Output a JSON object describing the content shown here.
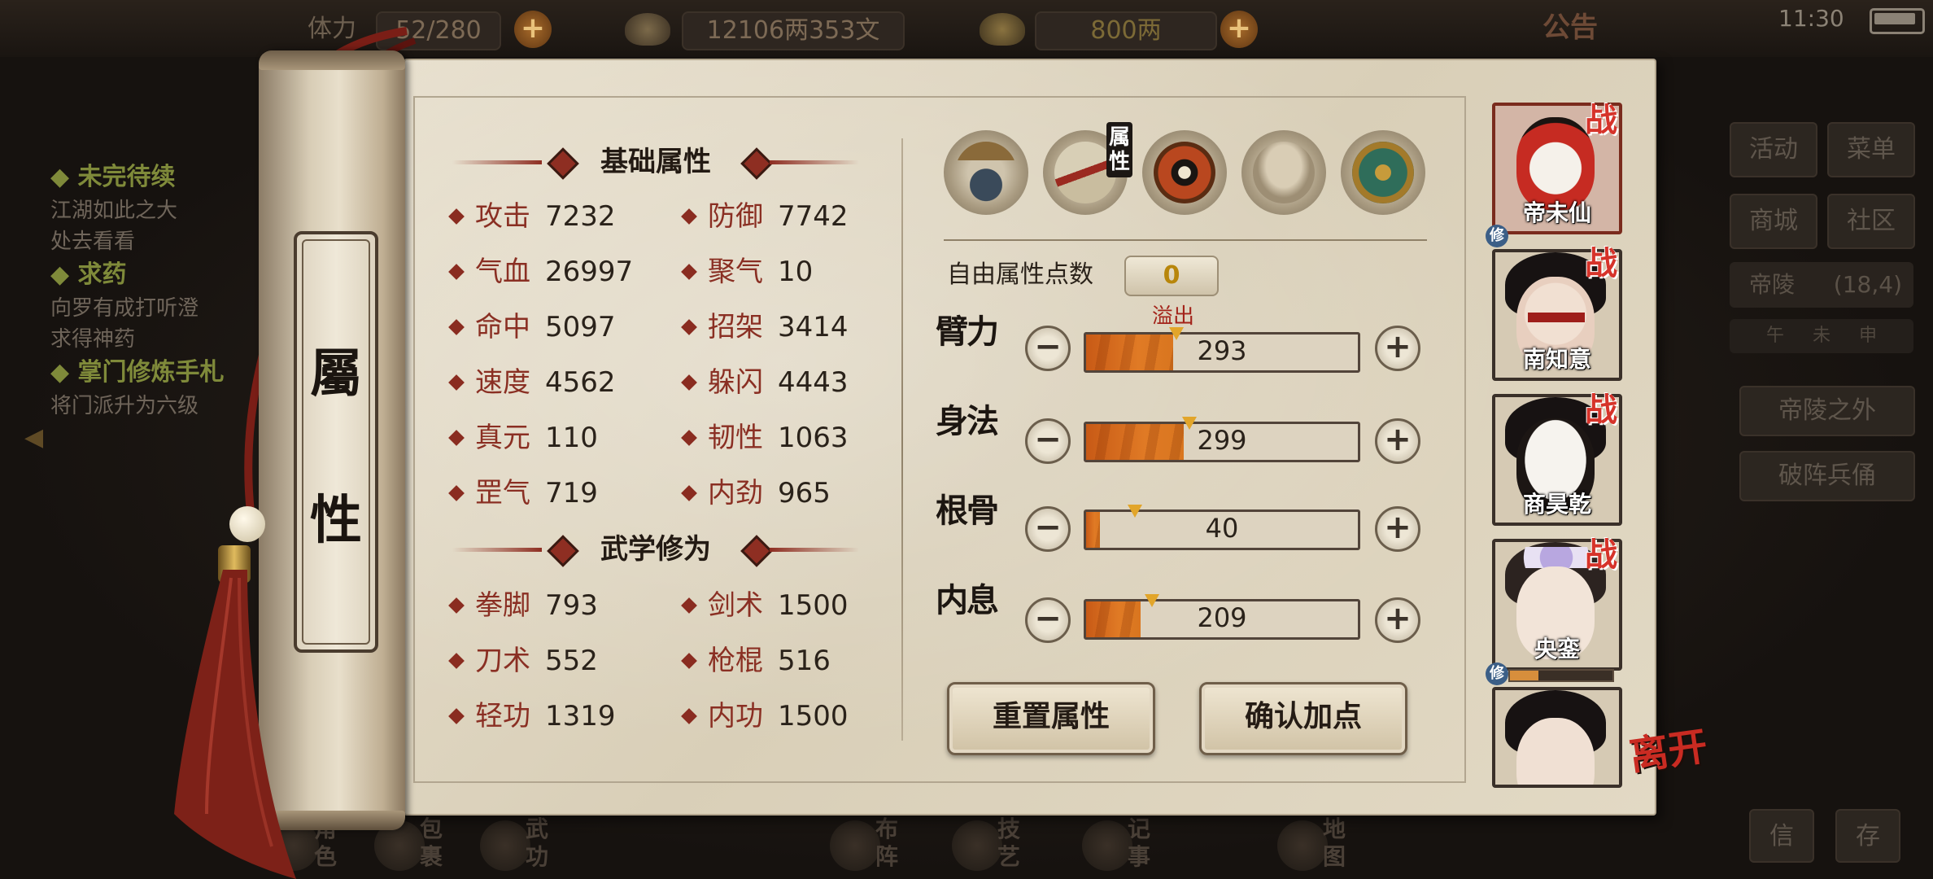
{
  "status": {
    "time": "11:30"
  },
  "topbar": {
    "stamina_label": "体力",
    "stamina": "52/280",
    "silver": "12106两353文",
    "gold": "800两",
    "notice": "公告"
  },
  "quests": [
    {
      "title": "未完待续",
      "lines": [
        "江湖如此之大",
        "处去看看"
      ]
    },
    {
      "title": "求药",
      "lines": [
        "向罗有成打听澄",
        "求得神药"
      ]
    },
    {
      "title": "掌门修炼手札",
      "lines": [
        "将门派升为六级"
      ]
    }
  ],
  "right_bg": {
    "buttons": [
      "活动",
      "菜单",
      "商城",
      "社区"
    ],
    "location": "帝陵",
    "coords": "(18,4)",
    "compass": [
      "午",
      "未",
      "申"
    ],
    "places": [
      "帝陵之外",
      "破阵兵俑"
    ],
    "bottom": [
      "信",
      "存"
    ]
  },
  "bottom_nav": [
    "角色",
    "包裹",
    "武功",
    "布阵",
    "技艺",
    "记事",
    "地图"
  ],
  "scroll_label": [
    "屬",
    "性"
  ],
  "sections": {
    "basic": "基础属性",
    "martial": "武学修为"
  },
  "basic_stats": [
    {
      "name": "攻击",
      "value": "7232"
    },
    {
      "name": "防御",
      "value": "7742"
    },
    {
      "name": "气血",
      "value": "26997"
    },
    {
      "name": "聚气",
      "value": "10"
    },
    {
      "name": "命中",
      "value": "5097"
    },
    {
      "name": "招架",
      "value": "3414"
    },
    {
      "name": "速度",
      "value": "4562"
    },
    {
      "name": "躲闪",
      "value": "4443"
    },
    {
      "name": "真元",
      "value": "110"
    },
    {
      "name": "韧性",
      "value": "1063"
    },
    {
      "name": "罡气",
      "value": "719"
    },
    {
      "name": "内劲",
      "value": "965"
    }
  ],
  "martial_stats": [
    {
      "name": "拳脚",
      "value": "793"
    },
    {
      "name": "剑术",
      "value": "1500"
    },
    {
      "name": "刀术",
      "value": "552"
    },
    {
      "name": "枪棍",
      "value": "516"
    },
    {
      "name": "轻功",
      "value": "1319"
    },
    {
      "name": "内功",
      "value": "1500"
    }
  ],
  "tab_icons": [
    "hat-icon",
    "scroll-icon",
    "bagua-icon",
    "muscle-icon",
    "compass-icon"
  ],
  "selected_tab_label": "属性",
  "free_points_label": "自由属性点数",
  "free_points": "0",
  "overflow_label": "溢出",
  "attributes": [
    {
      "name": "臂力",
      "value": "293",
      "fill": 0.32,
      "marker": 0.34
    },
    {
      "name": "身法",
      "value": "299",
      "fill": 0.36,
      "marker": 0.39
    },
    {
      "name": "根骨",
      "value": "40",
      "fill": 0.05,
      "marker": 0.19
    },
    {
      "name": "内息",
      "value": "209",
      "fill": 0.2,
      "marker": 0.25
    }
  ],
  "buttons": {
    "reset": "重置属性",
    "confirm": "确认加点"
  },
  "party": [
    {
      "name": "帝未仙",
      "battle": "战",
      "cultivate": "修"
    },
    {
      "name": "南知意",
      "battle": "战"
    },
    {
      "name": "商昊乾",
      "battle": "战"
    },
    {
      "name": "央銮",
      "battle": "战",
      "cultivate": "修"
    },
    {
      "name": ""
    }
  ],
  "leave": "离开",
  "colors": {
    "accent_red": "#8a2c20",
    "bar_orange": "#e07a25",
    "paper": "#e2d9c4"
  }
}
